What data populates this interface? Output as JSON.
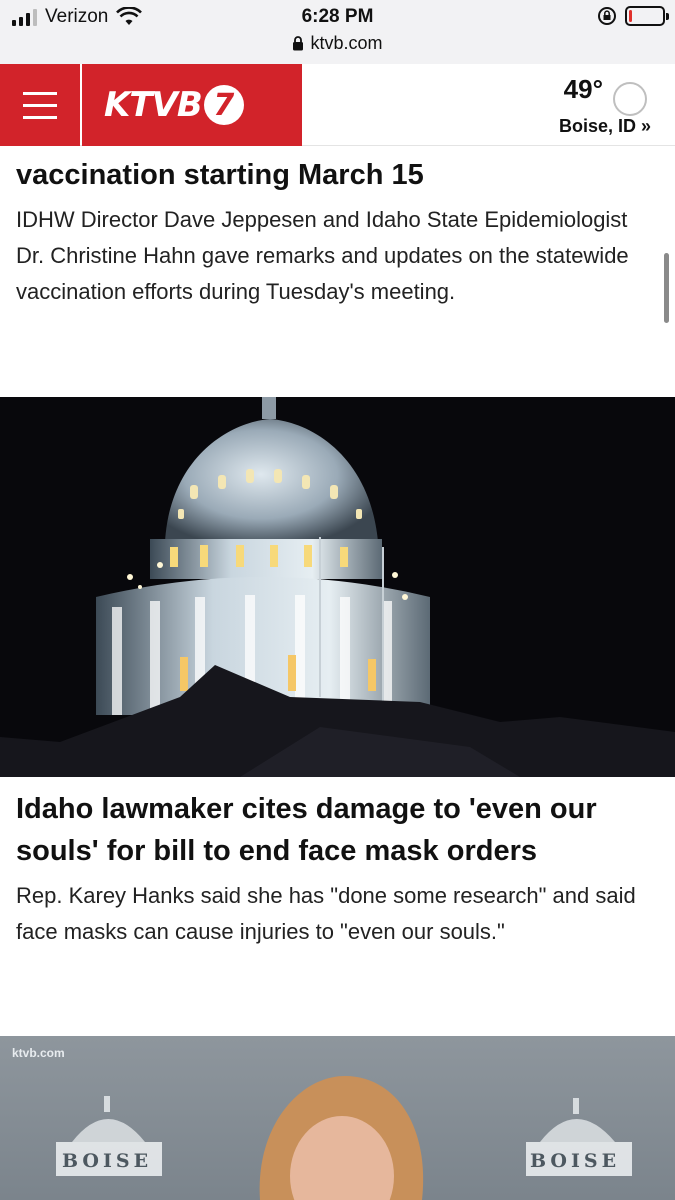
{
  "status_bar": {
    "carrier": "Verizon",
    "time": "6:28 PM",
    "url": "ktvb.com",
    "battery_level": 0.1
  },
  "header": {
    "logo_text": "KTVB",
    "logo_number": "7",
    "temperature": "49°",
    "location": "Boise, ID »",
    "colors": {
      "brand_red": "#d2232a"
    }
  },
  "articles": [
    {
      "title_partial": "vaccination starting March 15",
      "description": "IDHW Director Dave Jeppesen and Idaho State Epidemiologist Dr. Christine Hahn gave remarks and updates on the statewide vaccination efforts during Tuesday's meeting."
    },
    {
      "image": "idaho-capitol-dome-night",
      "title": "Idaho lawmaker cites damage to 'even our souls' for bill to end face mask orders",
      "description": "Rep. Karey Hanks said she has \"done some research\" and said face masks can cause injuries to \"even our souls.\""
    },
    {
      "image": "press-conference-boise-seal",
      "watermark": "ktvb.com",
      "seal_text": "BOISE"
    }
  ]
}
